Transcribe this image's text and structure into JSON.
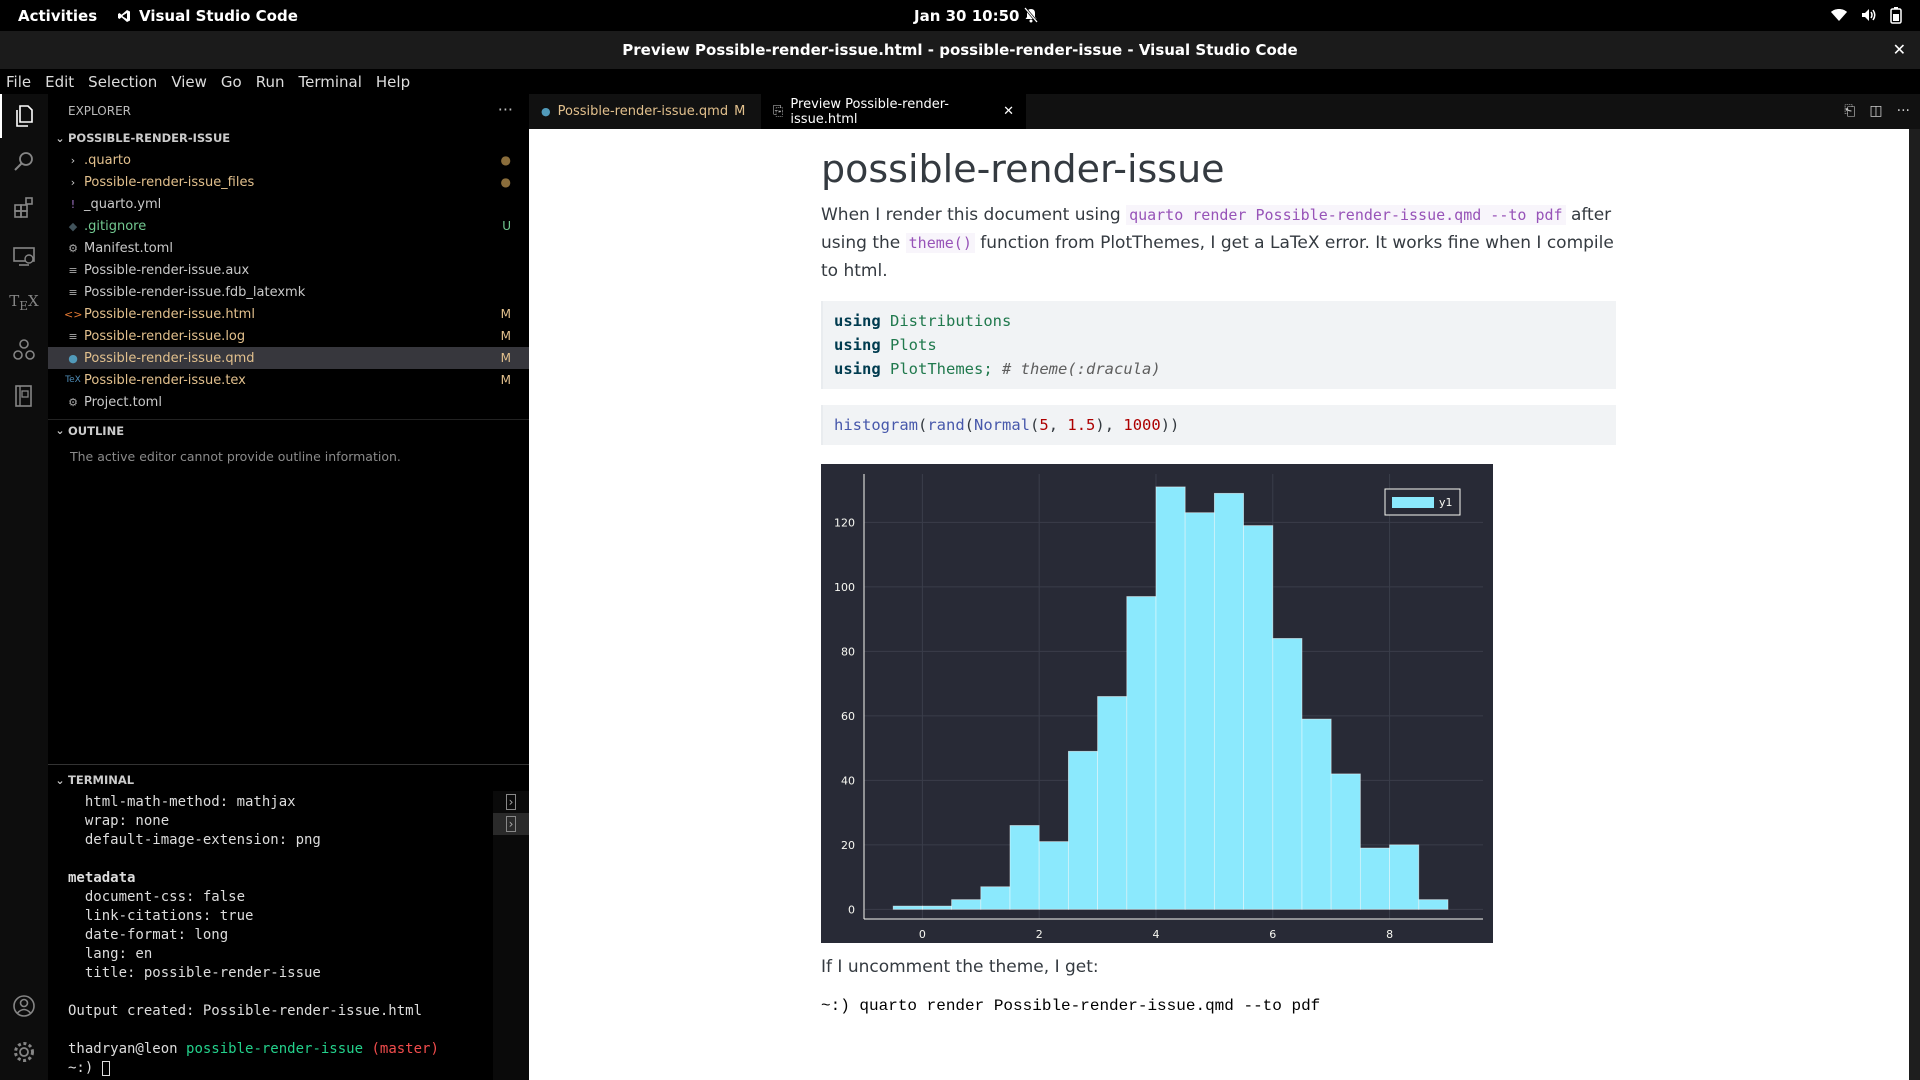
{
  "topbar": {
    "activities": "Activities",
    "app_name": "Visual Studio Code",
    "clock": "Jan 30  10:50"
  },
  "window": {
    "title": "Preview Possible-render-issue.html - possible-render-issue - Visual Studio Code"
  },
  "menu": [
    "File",
    "Edit",
    "Selection",
    "View",
    "Go",
    "Run",
    "Terminal",
    "Help"
  ],
  "explorer": {
    "header": "EXPLORER",
    "folder": "POSSIBLE-RENDER-ISSUE",
    "files": [
      {
        "name": ".quarto",
        "type": "folder",
        "badge": "●",
        "color": "mod"
      },
      {
        "name": "Possible-render-issue_files",
        "type": "folder",
        "badge": "●",
        "color": "mod"
      },
      {
        "name": "_quarto.yml",
        "type": "yml",
        "badge": "",
        "color": "dim"
      },
      {
        "name": ".gitignore",
        "type": "git",
        "badge": "U",
        "color": "untracked"
      },
      {
        "name": "Manifest.toml",
        "type": "toml",
        "badge": "",
        "color": "dim"
      },
      {
        "name": "Possible-render-issue.aux",
        "type": "txt",
        "badge": "",
        "color": "dim"
      },
      {
        "name": "Possible-render-issue.fdb_latexmk",
        "type": "txt",
        "badge": "",
        "color": "dim"
      },
      {
        "name": "Possible-render-issue.html",
        "type": "html",
        "badge": "M",
        "color": "mod"
      },
      {
        "name": "Possible-render-issue.log",
        "type": "txt",
        "badge": "M",
        "color": "mod"
      },
      {
        "name": "Possible-render-issue.qmd",
        "type": "qmd",
        "badge": "M",
        "color": "mod",
        "selected": true
      },
      {
        "name": "Possible-render-issue.tex",
        "type": "tex",
        "badge": "M",
        "color": "mod"
      },
      {
        "name": "Project.toml",
        "type": "toml",
        "badge": "",
        "color": "dim"
      }
    ],
    "outline_header": "OUTLINE",
    "outline_message": "The active editor cannot provide outline information."
  },
  "terminal": {
    "header": "TERMINAL",
    "lines": [
      {
        "text": "  html-math-method: mathjax",
        "style": ""
      },
      {
        "text": "  wrap: none",
        "style": ""
      },
      {
        "text": "  default-image-extension: png",
        "style": ""
      },
      {
        "text": "",
        "style": ""
      },
      {
        "text": "metadata",
        "style": "bold"
      },
      {
        "text": "  document-css: false",
        "style": ""
      },
      {
        "text": "  link-citations: true",
        "style": ""
      },
      {
        "text": "  date-format: long",
        "style": ""
      },
      {
        "text": "  lang: en",
        "style": ""
      },
      {
        "text": "  title: possible-render-issue",
        "style": ""
      },
      {
        "text": "",
        "style": ""
      },
      {
        "text": "Output created: Possible-render-issue.html",
        "style": ""
      },
      {
        "text": "",
        "style": ""
      }
    ],
    "prompt_user": "thadryan@leon",
    "prompt_dir": "possible-render-issue",
    "prompt_branch": "(master)",
    "prompt_line": "~:) "
  },
  "tabs": [
    {
      "label": "Possible-render-issue.qmd",
      "badge": "M"
    },
    {
      "label": "Preview Possible-render-issue.html"
    }
  ],
  "document": {
    "title": "possible-render-issue",
    "para1_a": "When I render this document using ",
    "para1_code1": "quarto render Possible-render-issue.qmd --to pdf",
    "para1_b": " after using the ",
    "para1_code2": "theme()",
    "para1_c": " function from PlotThemes, I get a LaTeX error. It works fine when I compile to html.",
    "code1": {
      "kw": "using",
      "l1": "Distributions",
      "l2": "Plots",
      "l3": "PlotThemes;",
      "l3_comment": "# theme(:dracula)"
    },
    "code2": {
      "fn1": "histogram",
      "fn2": "rand",
      "fn3": "Normal",
      "n1": "5",
      "n2": "1.5",
      "n3": "1000"
    },
    "para2": "If I uncomment the theme, I get:",
    "cmd": "~:) quarto render Possible-render-issue.qmd --to pdf"
  },
  "chart_data": {
    "type": "bar",
    "title": "",
    "xlabel": "",
    "ylabel": "",
    "series": [
      {
        "name": "y1",
        "color": "#8be9fd"
      }
    ],
    "bin_edges": [
      -0.5,
      0,
      0.5,
      1,
      1.5,
      2,
      2.5,
      3,
      3.5,
      4,
      4.5,
      5,
      5.5,
      6,
      6.5,
      7,
      7.5,
      8,
      8.5,
      9
    ],
    "values": [
      1,
      1,
      3,
      7,
      26,
      21,
      49,
      66,
      97,
      131,
      123,
      129,
      119,
      84,
      59,
      42,
      19,
      20,
      3
    ],
    "xticks": [
      "0",
      "2",
      "4",
      "6",
      "8"
    ],
    "yticks": [
      "0",
      "20",
      "40",
      "60",
      "80",
      "100",
      "120"
    ],
    "xlim": [
      -1,
      9.6
    ],
    "ylim": [
      -3,
      135
    ],
    "legend": "top-right",
    "background": "#282a36",
    "grid": true
  }
}
